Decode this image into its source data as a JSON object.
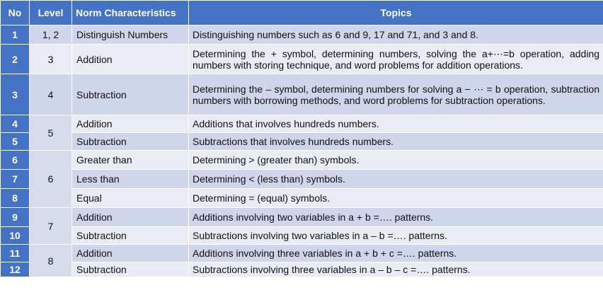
{
  "headers": {
    "no": "No",
    "level": "Level",
    "norm": "Norm Characteristics",
    "topics": "Topics"
  },
  "rows": [
    {
      "no": "1",
      "level": "1, 2",
      "norm": "Distinguish Numbers",
      "topic": "Distinguishing numbers such as 6 and 9, 17 and 71, and 3 and 8."
    },
    {
      "no": "2",
      "level": "3",
      "norm": "Addition",
      "topic": "Determining the + symbol, determining numbers, solving the a+⋯=b operation, adding numbers with storing technique, and word problems for addition operations."
    },
    {
      "no": "3",
      "level": "4",
      "norm": "Subtraction",
      "topic": "Determining the – symbol, determining numbers for solving a − ⋯ = b operation, subtraction numbers with borrowing methods, and word problems for subtraction operations."
    },
    {
      "no": "4",
      "level": "5",
      "norm": "Addition",
      "topic": "Additions that involves hundreds numbers."
    },
    {
      "no": "5",
      "level": "",
      "norm": "Subtraction",
      "topic": "Subtractions that involves hundreds numbers."
    },
    {
      "no": "6",
      "level": "6",
      "norm": "Greater than",
      "topic": "Determining  > (greater than) symbols."
    },
    {
      "no": "7",
      "level": "",
      "norm": "Less than",
      "topic": "Determining < (less than) symbols."
    },
    {
      "no": "8",
      "level": "",
      "norm": "Equal",
      "topic": "Determining = (equal) symbols."
    },
    {
      "no": "9",
      "level": "7",
      "norm": "Addition",
      "topic": "Additions involving two variables in a + b =…. patterns."
    },
    {
      "no": "10",
      "level": "",
      "norm": "Subtraction",
      "topic": "Subtractions involving two variables in a – b =…. patterns."
    },
    {
      "no": "11",
      "level": "8",
      "norm": "Addition",
      "topic": "Additions involving three variables in a + b + c =…. patterns."
    },
    {
      "no": "12",
      "level": "",
      "norm": "Subtraction",
      "topic": "Subtractions involving three variables in a – b – c =…. patterns."
    }
  ]
}
